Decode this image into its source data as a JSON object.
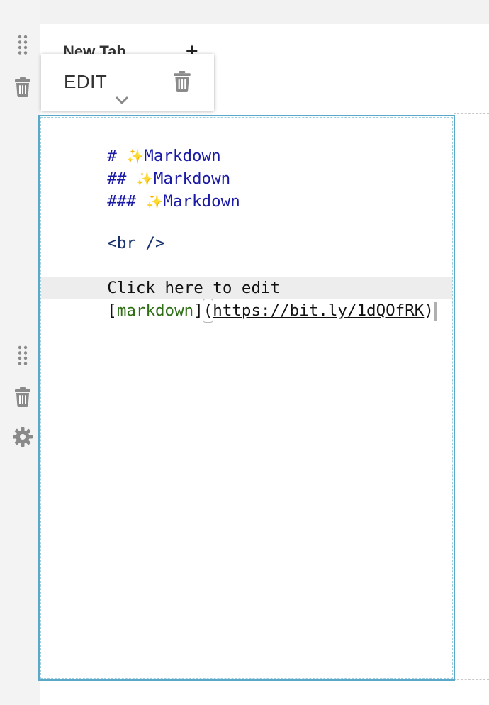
{
  "tab": {
    "title": "New Tab",
    "add_label": "+"
  },
  "toolbar": {
    "edit_label": "EDIT"
  },
  "editor": {
    "lines": {
      "h1_prefix": "# ",
      "h1_text": "Markdown",
      "h2_prefix": "## ",
      "h2_text": "Markdown",
      "h3_prefix": "### ",
      "h3_text": "Markdown",
      "br_open": "<",
      "br_name": "br",
      "br_close": " />",
      "para": "Click here to edit",
      "link_open": "[",
      "link_text": "markdown",
      "link_mid": "]",
      "link_paren_open": "(",
      "link_url": "https://bit.ly/1dQOfRK",
      "link_paren_close": ")"
    },
    "sparkle_glyph": "✨"
  },
  "icons": {
    "drag_handle_top": "drag-handle-icon",
    "trash_top": "trash-icon",
    "drag_handle_mid": "drag-handle-icon",
    "trash_mid": "trash-icon",
    "gear": "gear-icon",
    "toolbar_trash": "trash-icon",
    "toolbar_chevron": "chevron-down-icon"
  },
  "colors": {
    "frame_border": "#5aa9c8",
    "heading_text": "#1a1aa6",
    "link_text": "#2e6e15",
    "icon_gray": "#8a8a8a",
    "sparkle": "#e5b921"
  }
}
